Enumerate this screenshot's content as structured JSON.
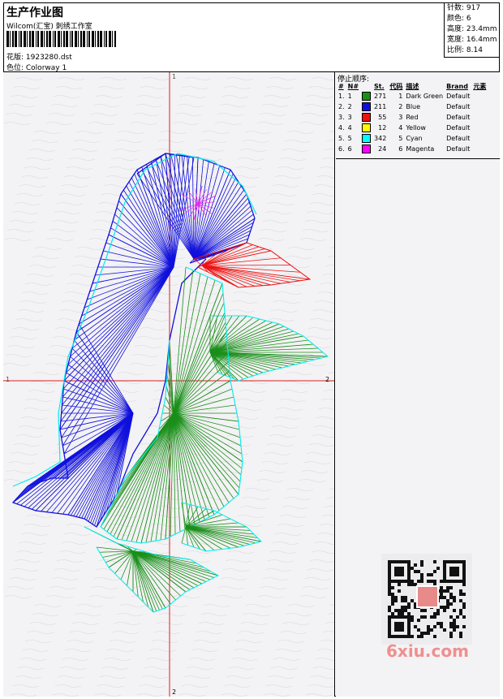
{
  "header": {
    "title": "生产作业图",
    "company": "Wilcom(汇宝) 刺绣工作室",
    "pattern": "花版: 1923280.dst",
    "colorway": "色位: Colorway 1"
  },
  "stats": {
    "stitches": "针数: 917",
    "colors": "颜色: 6",
    "height": "高度: 23.4mm",
    "width": "宽度: 16.4mm",
    "ratio": "比例: 8.14"
  },
  "axes": {
    "top_label": "1",
    "bottom_label": "2",
    "left_label": "1",
    "right_label": "2"
  },
  "stop_sequence": {
    "title": "停止顺序:",
    "columns": [
      "#",
      "N#",
      "St.",
      "代码",
      "描述",
      "Brand",
      "元素"
    ],
    "rows": [
      {
        "num": "1.",
        "n": "1",
        "color": "#1a8f1a",
        "st": "271",
        "code": "1",
        "desc": "Dark Green",
        "brand": "Default"
      },
      {
        "num": "2.",
        "n": "2",
        "color": "#1010dd",
        "st": "211",
        "code": "2",
        "desc": "Blue",
        "brand": "Default"
      },
      {
        "num": "3.",
        "n": "3",
        "color": "#ee1111",
        "st": "55",
        "code": "3",
        "desc": "Red",
        "brand": "Default"
      },
      {
        "num": "4.",
        "n": "4",
        "color": "#ffff00",
        "st": "12",
        "code": "4",
        "desc": "Yellow",
        "brand": "Default"
      },
      {
        "num": "5.",
        "n": "5",
        "color": "#00ffff",
        "st": "342",
        "code": "5",
        "desc": "Cyan",
        "brand": "Default"
      },
      {
        "num": "6.",
        "n": "6",
        "color": "#ff00ff",
        "st": "24",
        "code": "6",
        "desc": "Magenta",
        "brand": "Default"
      }
    ]
  },
  "watermark": "6xiu.com",
  "design_colors": {
    "blue": "#1010dd",
    "green": "#1a8f1a",
    "red": "#ee1111",
    "cyan": "#00eeee",
    "magenta": "#ee22ee",
    "axis": "#dd2020"
  }
}
